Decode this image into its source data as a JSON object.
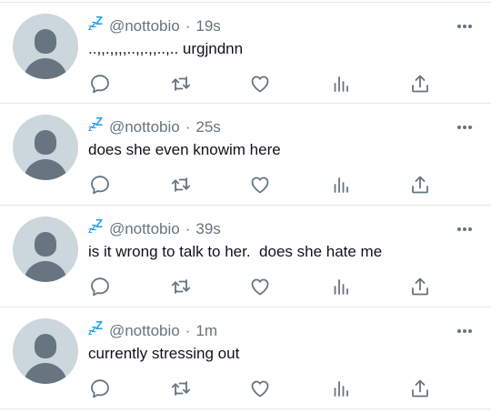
{
  "colors": {
    "accent": "#1d9bf0",
    "icon_gray": "#66757f",
    "divider": "#e6e9ec",
    "avatar_bg": "#ccd6dd"
  },
  "icons": {
    "reply": "reply-icon",
    "retweet": "retweet-icon",
    "like": "heart-icon",
    "stats": "stats-icon",
    "share": "share-icon",
    "more": "more-icon"
  },
  "tweets": [
    {
      "handle": "@nottobio",
      "separator": "·",
      "time": "19s",
      "text": "..,,.,,,,..,,.,,..,.. urgjndnn"
    },
    {
      "handle": "@nottobio",
      "separator": "·",
      "time": "25s",
      "text": "does she even knowim here"
    },
    {
      "handle": "@nottobio",
      "separator": "·",
      "time": "39s",
      "text": "is it wrong to talk to her.  does she hate me"
    },
    {
      "handle": "@nottobio",
      "separator": "·",
      "time": "1m",
      "text": "currently stressing out"
    }
  ]
}
